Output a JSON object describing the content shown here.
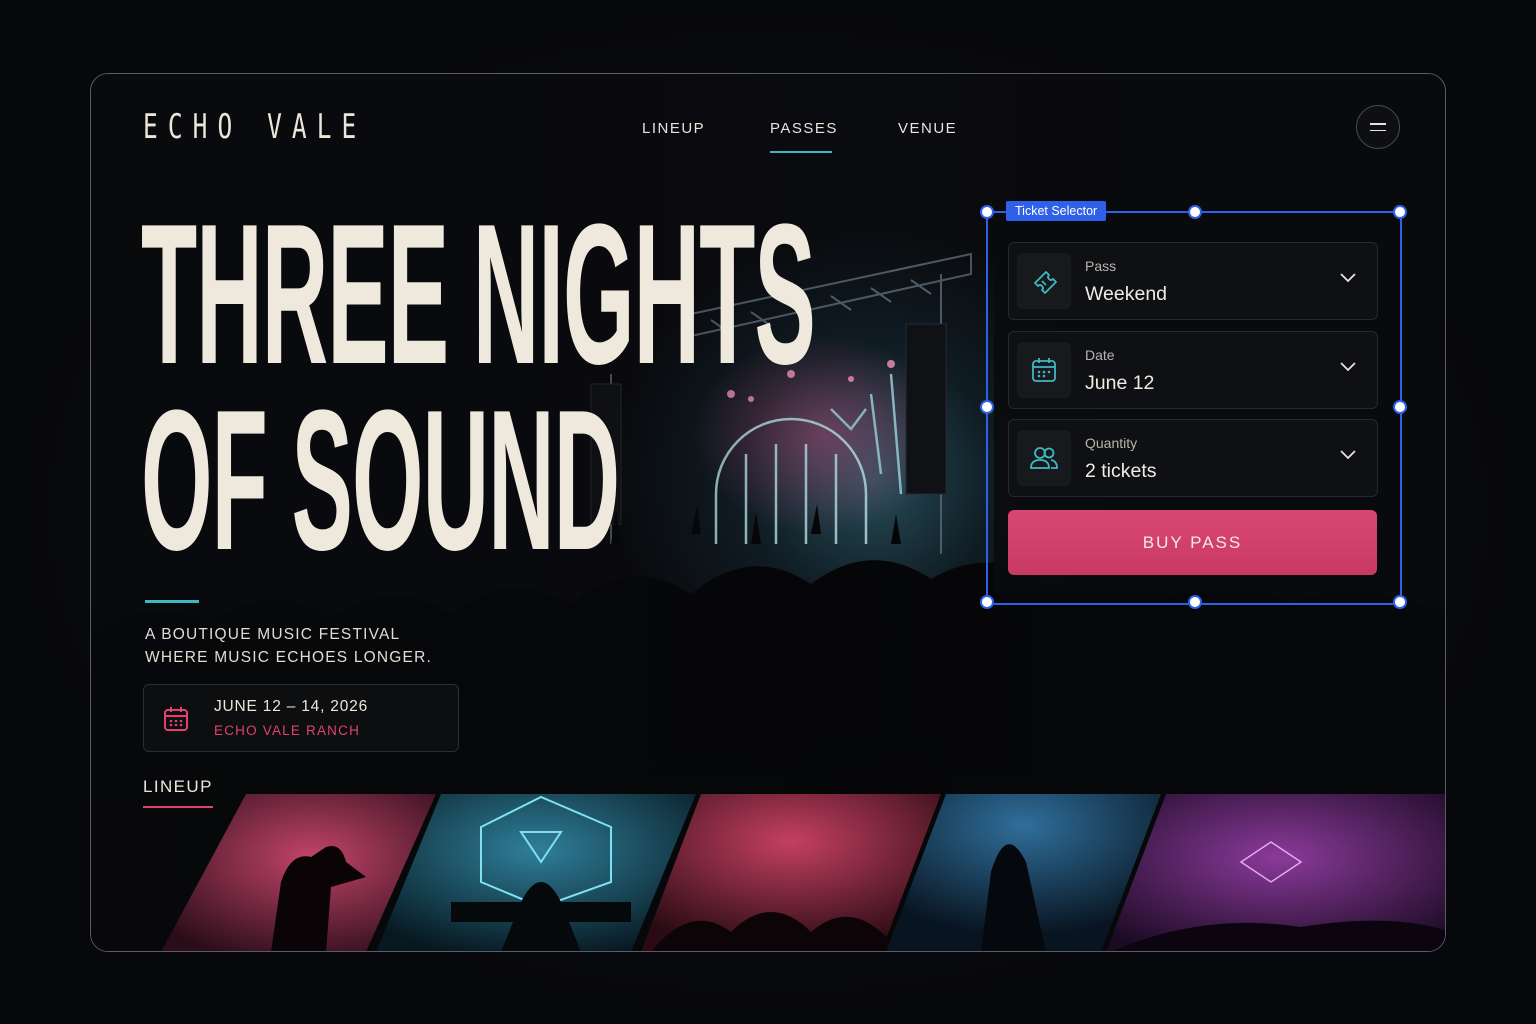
{
  "brand": {
    "logo": "ECHO VALE"
  },
  "nav": {
    "items": [
      "LINEUP",
      "PASSES",
      "VENUE"
    ],
    "active": "PASSES"
  },
  "hero": {
    "headline_line1": "THREE NIGHTS",
    "headline_line2": "OF SOUND",
    "tagline_line1": "A BOUTIQUE MUSIC FESTIVAL",
    "tagline_line2": "WHERE MUSIC ECHOES LONGER.",
    "dates": "JUNE 12 – 14, 2026",
    "location": "ECHO VALE RANCH"
  },
  "lineup": {
    "title": "LINEUP"
  },
  "ticket_selector": {
    "tag": "Ticket Selector",
    "fields": [
      {
        "label": "Pass",
        "value": "Weekend",
        "icon": "ticket-icon"
      },
      {
        "label": "Date",
        "value": "June 12",
        "icon": "calendar-icon"
      },
      {
        "label": "Quantity",
        "value": "2 tickets",
        "icon": "users-icon"
      }
    ],
    "cta": "BUY PASS"
  },
  "colors": {
    "accent_teal": "#3fb8c4",
    "accent_pink": "#e0416f",
    "button": "#d0406a",
    "selection": "#2f61e8"
  }
}
